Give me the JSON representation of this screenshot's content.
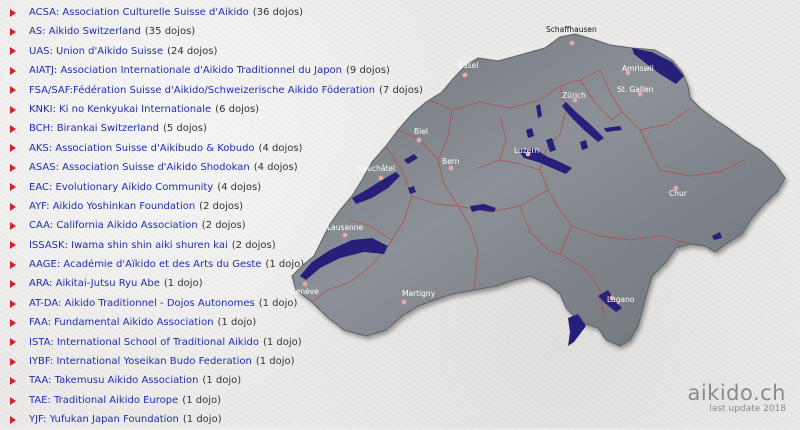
{
  "associations": [
    {
      "name": "ACSA: Association Culturelle Suisse d'Aikido",
      "count": "(36 dojos)"
    },
    {
      "name": "AS: Aikido Switzerland",
      "count": "(35 dojos)"
    },
    {
      "name": "UAS: Union d'Aikido Suisse",
      "count": "(24 dojos)"
    },
    {
      "name": "AIATJ: Association Internationale d'Aikido Traditionnel du Japon",
      "count": "(9 dojos)"
    },
    {
      "name": "FSA/SAF:Fédération Suisse d'Aikido/Schweizerische Aikido Föderation",
      "count": "(7 dojos)"
    },
    {
      "name": "KNKI: Ki no Kenkyukai Internationale",
      "count": "(6 dojos)"
    },
    {
      "name": "BCH: Birankai Switzerland",
      "count": "(5 dojos)"
    },
    {
      "name": "AKS: Association Suisse d'Aikibudo & Kobudo",
      "count": "(4 dojos)"
    },
    {
      "name": "ASAS: Association Suisse d'Aikido Shodokan",
      "count": "(4 dojos)"
    },
    {
      "name": "EAC: Evolutionary Aikido Community",
      "count": "(4 dojos)"
    },
    {
      "name": "AYF: Aikido Yoshinkan Foundation",
      "count": "(2 dojos)"
    },
    {
      "name": "CAA: California Aikido Association",
      "count": "(2 dojos)"
    },
    {
      "name": "ISSASK: Iwama shin shin aiki shuren kai",
      "count": "(2 dojos)"
    },
    {
      "name": "AAGE: Académie d'Aïkido et des Arts du Geste",
      "count": "(1 dojo)"
    },
    {
      "name": "ARA: Aikitai-Jutsu Ryu Abe",
      "count": "(1 dojo)"
    },
    {
      "name": "AT-DA: Aikido Traditionnel - Dojos Autonomes",
      "count": "(1 dojo)"
    },
    {
      "name": "FAA: Fundamental Aikido Association",
      "count": "(1 dojo)"
    },
    {
      "name": "ISTA: International School of Traditional Aikido",
      "count": "(1 dojo)"
    },
    {
      "name": "IYBF: International Yoseikan Budo Federation",
      "count": "(1 dojo)"
    },
    {
      "name": "TAA: Takemusu Aikido Association",
      "count": "(1 dojo)"
    },
    {
      "name": "TAE: Traditional Aikido Europe",
      "count": "(1 dojo)"
    },
    {
      "name": "YJF: Yufukan Japan Foundation",
      "count": "(1 dojo)"
    }
  ],
  "map": {
    "cities": {
      "schaffhausen": "Schaffhausen",
      "basel": "Basel",
      "amriswil": "Amriswil",
      "zurich": "Zürich",
      "st_gallen": "St. Gallen",
      "biel": "Biel",
      "bern": "Bern",
      "luzern": "Luzern",
      "neuchatel": "Neuchâtel",
      "chur": "Chur",
      "lausanne": "Lausanne",
      "geneve": "Genève",
      "martigny": "Martigny",
      "lugano": "Lugano"
    },
    "colors": {
      "land": "#7a8086",
      "lakes": "#26207a",
      "borders": "#b54a48",
      "dots": "#e8a9a9"
    }
  },
  "brand": {
    "site": "aikido.ch",
    "updated": "last update 2018"
  }
}
